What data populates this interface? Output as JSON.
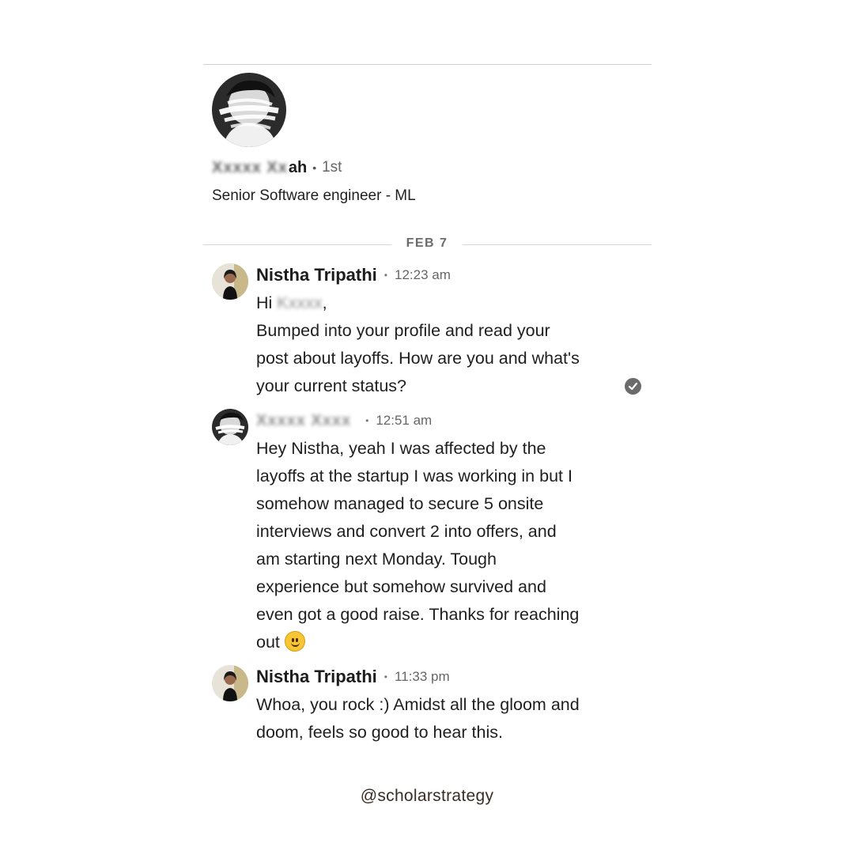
{
  "profile": {
    "name_visible_fragment": "ah",
    "connection_degree": "1st",
    "headline": "Senior Software engineer - ML"
  },
  "conversation": {
    "date_divider": "FEB 7",
    "messages": [
      {
        "sender": "Nistha Tripathi",
        "time": "12:23 am",
        "lines": [
          "Hi",
          "Bumped into your profile and read your",
          "post about layoffs. How are you and what's",
          "your current status?"
        ]
      },
      {
        "sender": "",
        "time": "12:51 am",
        "lines": [
          "Hey Nistha, yeah I was affected by the",
          "layoffs at the startup I was working in but I",
          "somehow managed to secure 5 onsite",
          "interviews and convert 2 into offers, and",
          "am starting next Monday. Tough",
          "experience but somehow survived and",
          "even got a good raise. Thanks for reaching",
          "out"
        ]
      },
      {
        "sender": "Nistha Tripathi",
        "time": "11:33 pm",
        "lines": [
          "Whoa, you rock :) Amidst all the gloom and",
          "doom, feels so good to hear this."
        ]
      }
    ]
  },
  "icons": {
    "read_receipt": "check-circle-icon",
    "emoji": "slightly-smiling-face-icon"
  },
  "watermark": "@scholarstrategy"
}
